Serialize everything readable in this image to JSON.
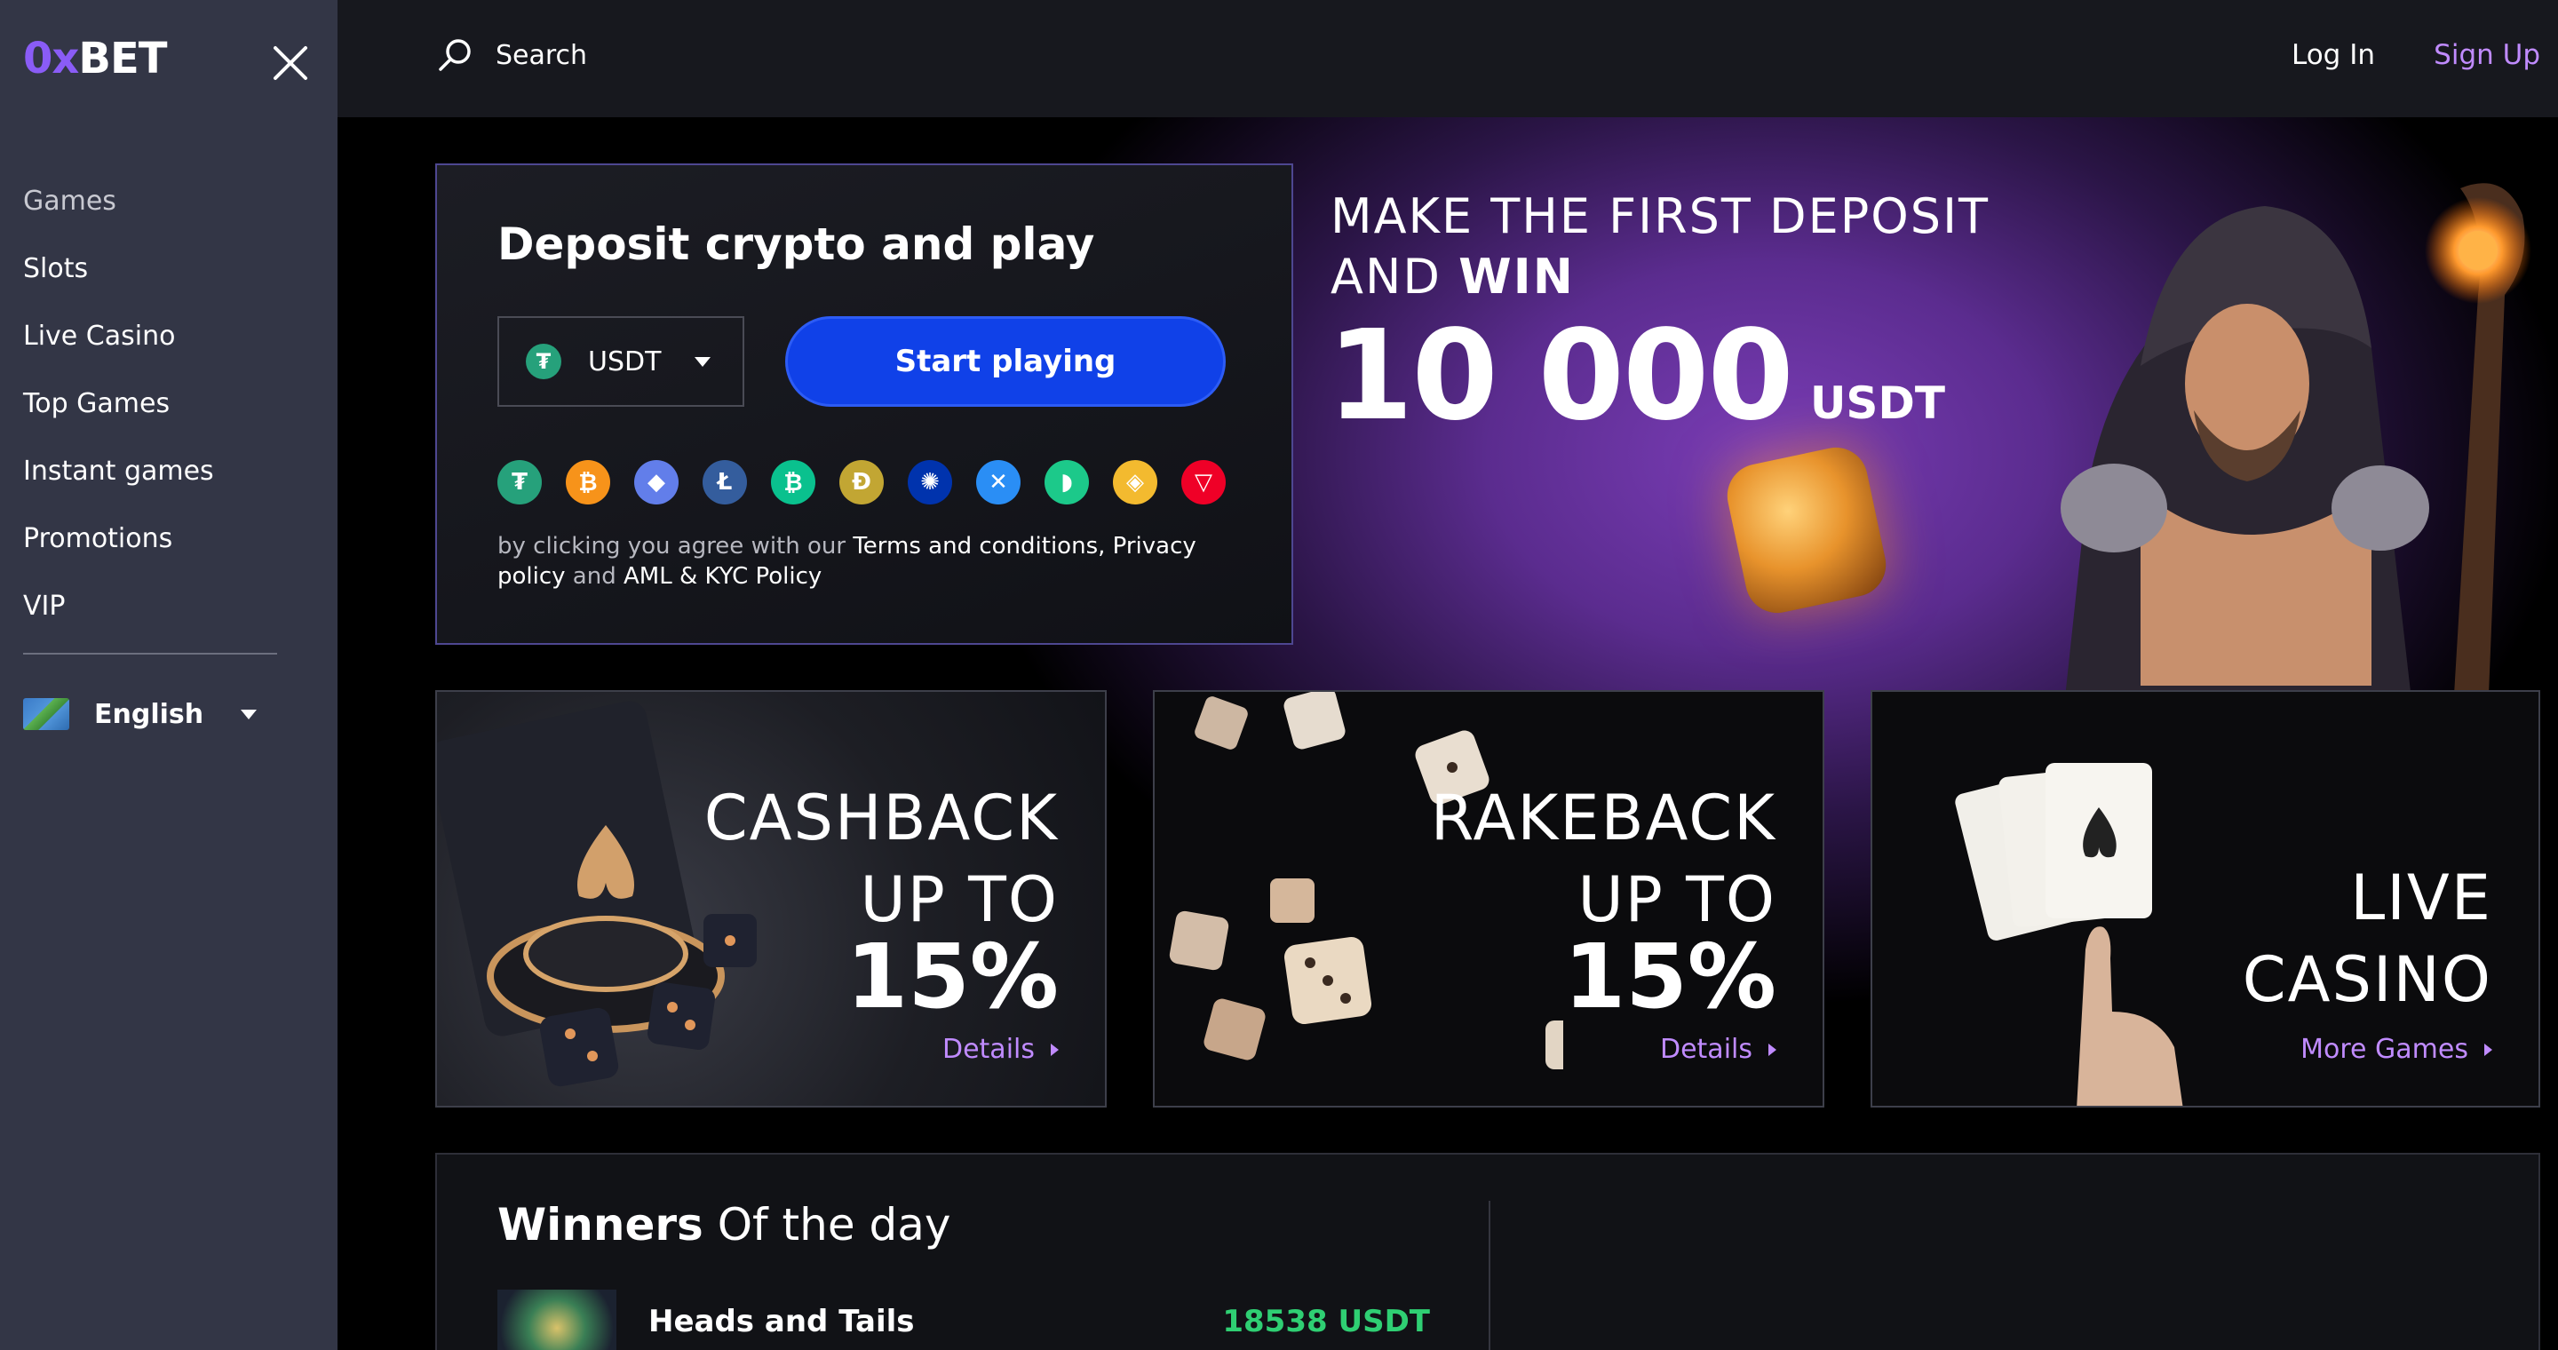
{
  "brand": {
    "logo_prefix": "0",
    "logo_x": "x",
    "logo_rest": "BET"
  },
  "sidebar": {
    "items": [
      {
        "label": "Games"
      },
      {
        "label": "Slots"
      },
      {
        "label": "Live Casino"
      },
      {
        "label": "Top Games"
      },
      {
        "label": "Instant games"
      },
      {
        "label": "Promotions"
      },
      {
        "label": "VIP"
      }
    ],
    "language": "English"
  },
  "header": {
    "search_label": "Search",
    "login_label": "Log In",
    "signup_label": "Sign Up"
  },
  "deposit": {
    "title": "Deposit crypto and play",
    "currency": "USDT",
    "start_button": "Start playing",
    "coins": [
      {
        "name": "tether-icon",
        "symbol": "₮",
        "color": "#26a17b"
      },
      {
        "name": "bitcoin-icon",
        "symbol": "₿",
        "color": "#f7931a"
      },
      {
        "name": "ethereum-icon",
        "symbol": "◆",
        "color": "#627eea"
      },
      {
        "name": "litecoin-icon",
        "symbol": "Ł",
        "color": "#345d9d"
      },
      {
        "name": "bitcoin-cash-icon",
        "symbol": "₿",
        "color": "#0ac18e"
      },
      {
        "name": "dogecoin-icon",
        "symbol": "Ð",
        "color": "#c2a633"
      },
      {
        "name": "cardano-icon",
        "symbol": "✺",
        "color": "#0033ad"
      },
      {
        "name": "ripple-icon",
        "symbol": "✕",
        "color": "#2a8ef5"
      },
      {
        "name": "tron-green-icon",
        "symbol": "◗",
        "color": "#1cc98a"
      },
      {
        "name": "binance-icon",
        "symbol": "◈",
        "color": "#f3ba2f"
      },
      {
        "name": "tron-icon",
        "symbol": "▽",
        "color": "#ef0027"
      }
    ],
    "agree_prefix": "by clicking you agree with our ",
    "terms_link": "Terms and conditions, Privacy policy",
    "agree_and": " and ",
    "aml_link": "AML & KYC Policy"
  },
  "promo": {
    "line1": "MAKE THE FIRST DEPOSIT",
    "line2_prefix": "AND ",
    "line2_bold": "WIN",
    "amount": "10 000",
    "currency": "USDT"
  },
  "cards": [
    {
      "title1": "CASHBACK",
      "title2": "UP TO",
      "pct": "15%",
      "link": "Details"
    },
    {
      "title1": "RAKEBACK",
      "title2": "UP TO",
      "pct": "15%",
      "link": "Details"
    },
    {
      "title1": "LIVE",
      "title2": "CASINO",
      "link": "More Games"
    }
  ],
  "winners": {
    "title_bold": "Winners",
    "title_rest": " Of the day",
    "rows": [
      {
        "game": "Heads and Tails",
        "amount": "18538 USDT"
      }
    ]
  },
  "colors": {
    "accent": "#c08bff",
    "button": "#1041e8",
    "win": "#2fcf73",
    "sidebar": "#333646"
  }
}
